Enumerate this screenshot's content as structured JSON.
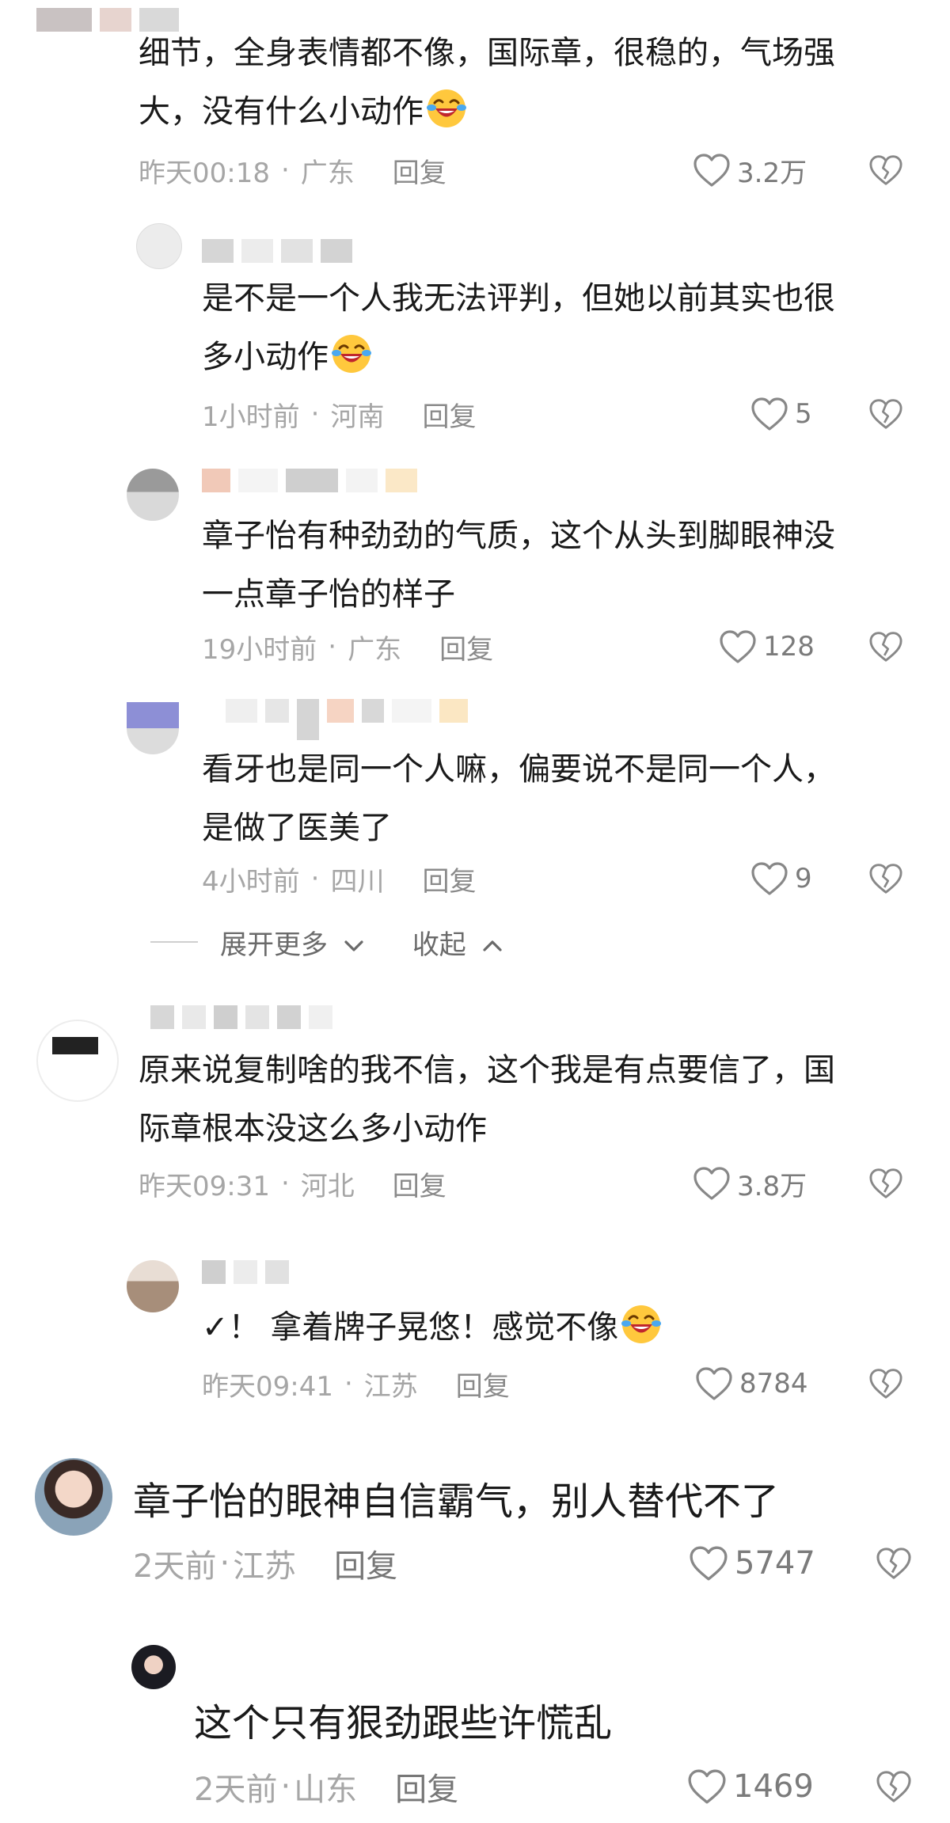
{
  "colors": {
    "text": "#1a1a1a",
    "meta": "#a6a6a6",
    "icon": "#8a8a8a",
    "background": "#ffffff"
  },
  "comments": [
    {
      "lines": [
        "细节，全身表情都不像，国际章，很稳的，气场强",
        "大，没有什么小动作"
      ],
      "emoji": "laughing-crying-emoji",
      "time": "昨天00:18",
      "location": "广东",
      "reply": "回复",
      "likes": "3.2万"
    },
    {
      "lines": [
        "是不是一个人我无法评判，但她以前其实也很",
        "多小动作"
      ],
      "emoji": "laughing-crying-emoji",
      "time": "1小时前",
      "location": "河南",
      "reply": "回复",
      "likes": "5"
    },
    {
      "lines": [
        "章子怡有种劲劲的气质，这个从头到脚眼神没",
        "一点章子怡的样子"
      ],
      "time": "19小时前",
      "location": "广东",
      "reply": "回复",
      "likes": "128"
    },
    {
      "lines": [
        "看牙也是同一个人嘛，偏要说不是同一个人，",
        "是做了医美了"
      ],
      "time": "4小时前",
      "location": "四川",
      "reply": "回复",
      "likes": "9"
    },
    {
      "lines": [
        "原来说复制啥的我不信，这个我是有点要信了，国",
        "际章根本没这么多小动作"
      ],
      "time": "昨天09:31",
      "location": "河北",
      "reply": "回复",
      "likes": "3.8万"
    },
    {
      "lines": [
        "✓！ 拿着牌子晃悠！感觉不像"
      ],
      "emoji": "laughing-crying-emoji",
      "time": "昨天09:41",
      "location": "江苏",
      "reply": "回复",
      "likes": "8784"
    },
    {
      "lines": [
        "章子怡的眼神自信霸气，别人替代不了"
      ],
      "time": "2天前",
      "location": "江苏",
      "reply": "回复",
      "likes": "5747"
    },
    {
      "lines": [
        "这个只有狠劲跟些许慌乱"
      ],
      "time": "2天前",
      "location": "山东",
      "reply": "回复",
      "likes": "1469"
    }
  ],
  "expand": {
    "more_label": "展开更多",
    "collapse_label": "收起"
  }
}
